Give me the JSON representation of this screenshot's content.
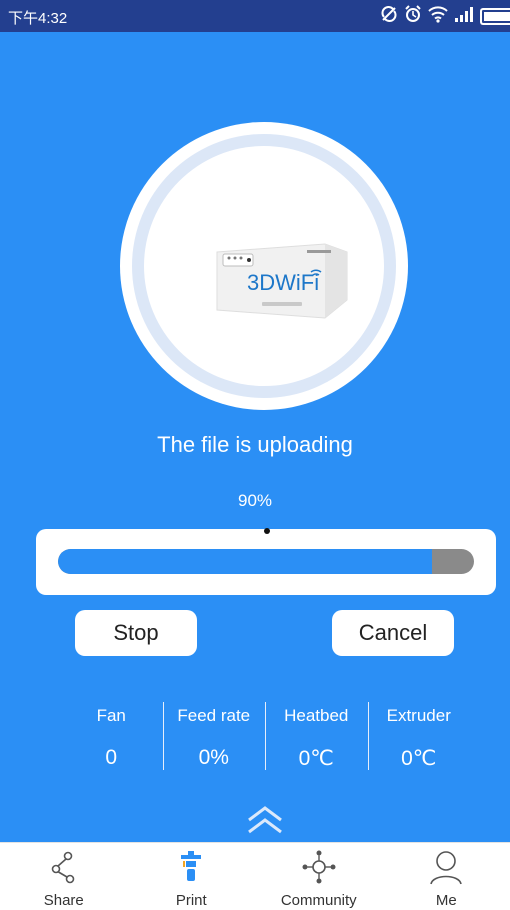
{
  "status_bar": {
    "time": "下午4:32",
    "icons": [
      "no-sync-icon",
      "alarm-icon",
      "wifi-icon",
      "signal-icon",
      "battery-icon"
    ]
  },
  "device": {
    "logo_text": "3DWiFi",
    "image": "3dwifi-box-device"
  },
  "upload": {
    "title": "The file is uploading",
    "percent_label": "90%",
    "progress": 0.9
  },
  "actions": {
    "stop_label": "Stop",
    "cancel_label": "Cancel"
  },
  "stats": [
    {
      "label": "Fan",
      "value": "0"
    },
    {
      "label": "Feed rate",
      "value": "0%"
    },
    {
      "label": "Heatbed",
      "value": "0℃"
    },
    {
      "label": "Extruder",
      "value": "0℃"
    }
  ],
  "nav": [
    {
      "label": "Share",
      "icon": "share-icon"
    },
    {
      "label": "Print",
      "icon": "print-icon"
    },
    {
      "label": "Community",
      "icon": "community-icon"
    },
    {
      "label": "Me",
      "icon": "user-icon"
    }
  ],
  "colors": {
    "status_bar": "#233f8f",
    "background": "#2b8ff5",
    "progress_remaining": "#8a8a8a",
    "print_icon_accent": "#2b8ff5"
  }
}
